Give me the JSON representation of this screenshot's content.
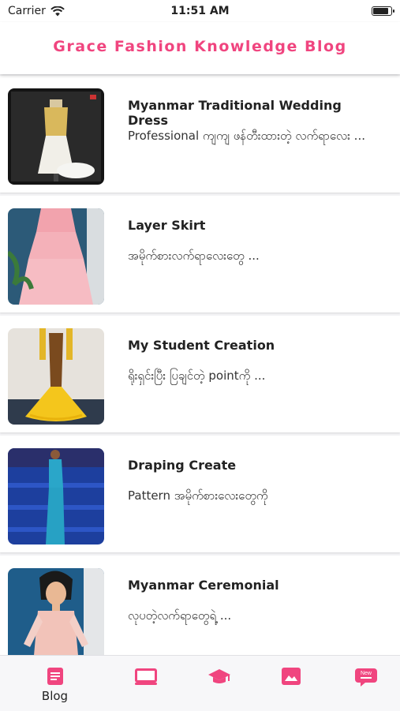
{
  "status": {
    "carrier": "Carrier",
    "time": "11:51 AM",
    "battery_level": 0.9
  },
  "header": {
    "title": "Grace Fashion Knowledge Blog"
  },
  "posts": [
    {
      "title": "Myanmar Traditional Wedding Dress",
      "excerpt": "Professional ကျကျ ဖန်တီးထားတဲ့ လက်ရာလေး ..."
    },
    {
      "title": "Layer Skirt",
      "excerpt": "အမိုက်စားလက်ရာလေးတွေ ..."
    },
    {
      "title": "My Student Creation",
      "excerpt": "ရိုးရှင်းပြီး ပြချင်တဲ့ pointကို ..."
    },
    {
      "title": "Draping Create",
      "excerpt": "Pattern အမိုက်စားလေးတွေကို"
    },
    {
      "title": "Myanmar Ceremonial",
      "excerpt": "လုပတဲ့လက်ရာတွေရဲ့ ..."
    }
  ],
  "tabbar": {
    "accent": "#f0457f",
    "tabs": [
      {
        "icon": "blog-icon",
        "label": "Blog"
      },
      {
        "icon": "video-icon",
        "label": ""
      },
      {
        "icon": "graduation-cap-icon",
        "label": ""
      },
      {
        "icon": "image-icon",
        "label": ""
      },
      {
        "icon": "new-badge-icon",
        "badge": "New",
        "label": ""
      }
    ]
  }
}
